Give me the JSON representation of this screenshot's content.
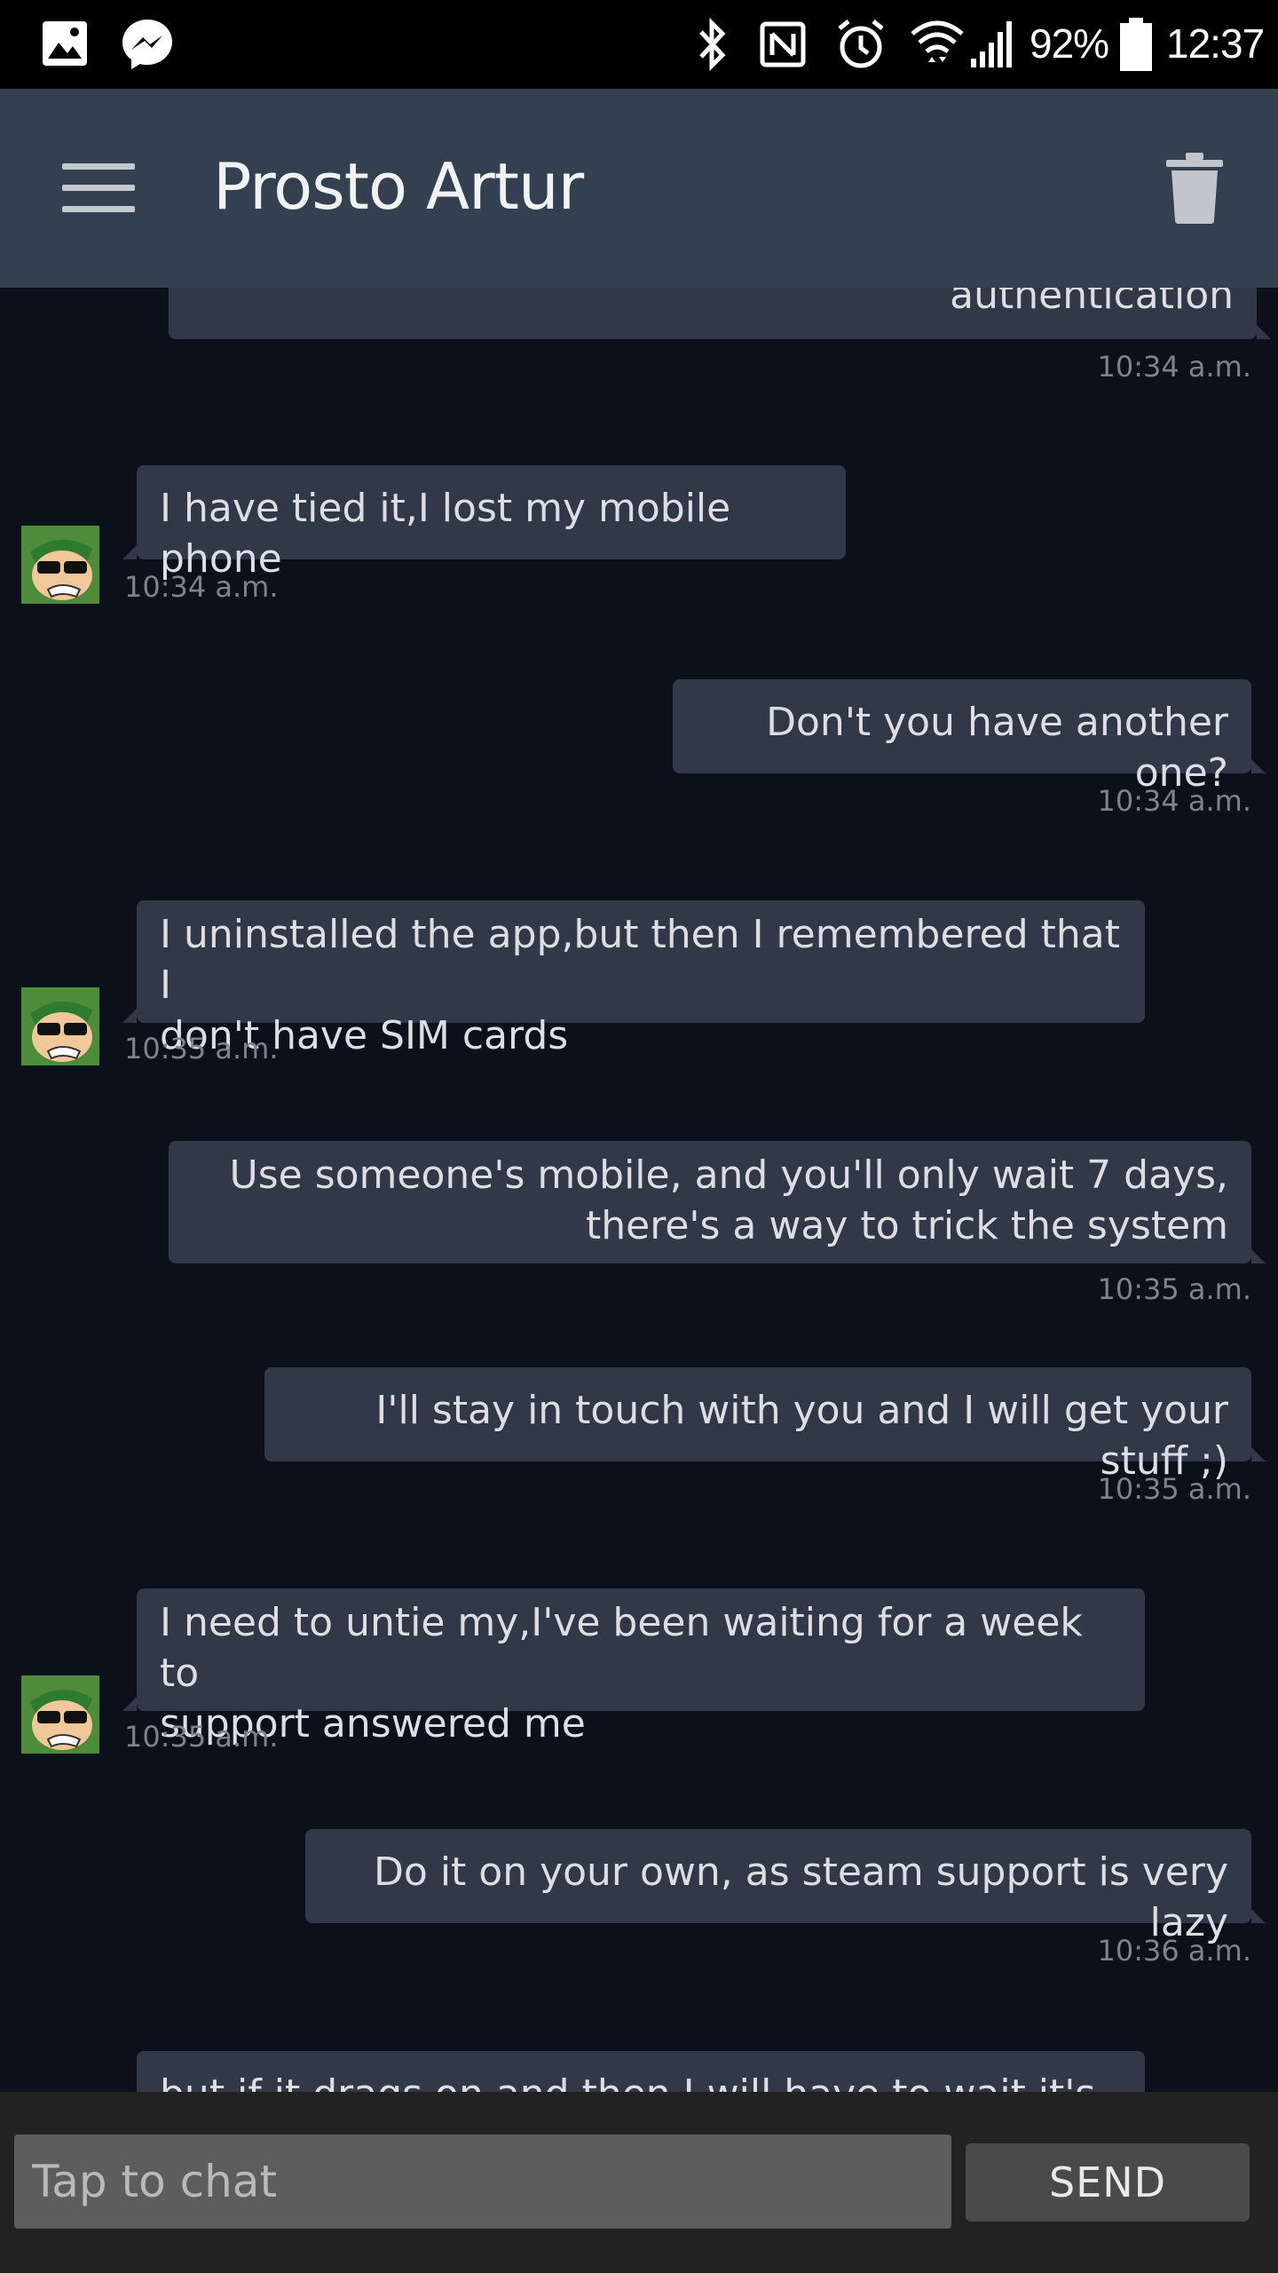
{
  "status_bar": {
    "battery": "92%",
    "time": "12:37",
    "icons": [
      "image-icon",
      "messenger-icon",
      "bluetooth-icon",
      "nfc-icon",
      "alarm-icon",
      "wifi-icon",
      "signal-icon",
      "battery-icon"
    ]
  },
  "header": {
    "title": "Prosto Artur",
    "menu_icon": "hamburger-menu-icon",
    "delete_icon": "trash-icon"
  },
  "messages": [
    {
      "dir": "out",
      "lines": [
        "authentication"
      ],
      "time": "10:34 a.m."
    },
    {
      "dir": "in",
      "lines": [
        "I have tied it,I lost my mobile phone"
      ],
      "time": "10:34 a.m."
    },
    {
      "dir": "out",
      "lines": [
        "Don't you have another one?"
      ],
      "time": "10:34 a.m."
    },
    {
      "dir": "in",
      "lines": [
        "I uninstalled the app,but then I remembered that I",
        "don't have SIM cards"
      ],
      "time": "10:35 a.m."
    },
    {
      "dir": "out",
      "lines": [
        "Use someone's mobile, and you'll only wait 7 days,",
        "there's a way to trick the system"
      ],
      "time": "10:35 a.m."
    },
    {
      "dir": "out",
      "lines": [
        "I'll stay in touch with you and I will get your stuff ;)"
      ],
      "time": "10:35 a.m."
    },
    {
      "dir": "in",
      "lines": [
        "I need to untie my,I've been waiting for a week to",
        "support answered me"
      ],
      "time": "10:35 a.m."
    },
    {
      "dir": "out",
      "lines": [
        "Do it on your own, as steam support is very lazy"
      ],
      "time": "10:36 a.m."
    },
    {
      "dir": "in",
      "lines": [
        "but if it drags on and then I will have to wait it's"
      ],
      "time": ""
    }
  ],
  "composer": {
    "placeholder": "Tap to chat",
    "send_label": "SEND"
  },
  "colors": {
    "background": "#0b111a",
    "header": "#34404f",
    "bubble": "#313848",
    "timestamp": "#7d838d"
  }
}
